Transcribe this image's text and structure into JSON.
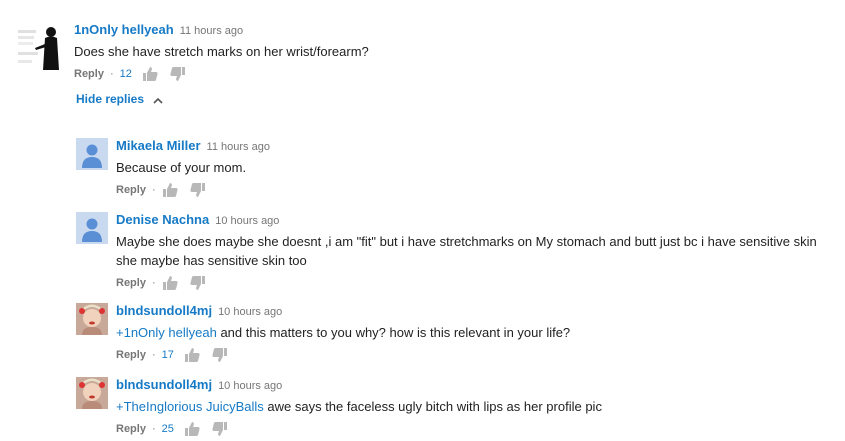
{
  "comment": {
    "author": "1nOnly hellyeah",
    "time": "11 hours ago",
    "text": "Does she have stretch marks on her wrist/forearm?",
    "reply_label": "Reply",
    "separator": "·",
    "like_count": "12"
  },
  "hide_replies_label": "Hide replies",
  "replies": [
    {
      "author": "Mikaela Miller",
      "time": "11 hours ago",
      "text": "Because of your mom.",
      "reply_label": "Reply",
      "separator": "·"
    },
    {
      "author": "Denise Nachna",
      "time": "10 hours ago",
      "text_line1": "Maybe she does maybe she doesnt ,i am \"fit\" but i have stretchmarks on My stomach and butt just bc i have sensitive skin",
      "text_line2": "she maybe has sensitive skin too",
      "reply_label": "Reply",
      "separator": "·"
    },
    {
      "author": "blndsundoll4mj",
      "time": "10 hours ago",
      "mention": "+1nOnly hellyeah",
      "text": " and this matters to you why? how is this relevant in your life?",
      "reply_label": "Reply",
      "separator": "·",
      "like_count": "17"
    },
    {
      "author": "blndsundoll4mj",
      "time": "10 hours ago",
      "mention": "+TheInglorious JuicyBalls",
      "text": " awe says the faceless ugly bitch with lips as her profile pic",
      "reply_label": "Reply",
      "separator": "·",
      "like_count": "25"
    }
  ],
  "icons": {
    "like": "thumbs-up-icon",
    "dislike": "thumbs-down-icon",
    "chevron": "chevron-up-icon"
  },
  "colors": {
    "link": "#167ac6",
    "meta": "#767676",
    "icon": "#b8b8b8",
    "default_avatar": "#c9d9ef",
    "default_avatar_figure": "#5a8fd6"
  }
}
